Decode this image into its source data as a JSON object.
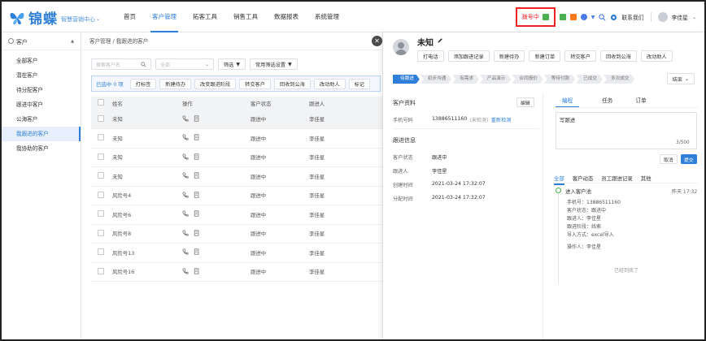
{
  "app": {
    "logo_text": "锦蝶",
    "logo_sub": "智慧营销中心",
    "nav": [
      "首页",
      "客户管理",
      "拓客工具",
      "销售工具",
      "数据报表",
      "系统管理"
    ],
    "nav_active": 1,
    "dial_status": "拨号中",
    "contact_us": "联系我们",
    "user": "李佳星"
  },
  "sidebar": {
    "header": "客户",
    "items": [
      "全部客户",
      "潜在客户",
      "待分配客户",
      "跟进中客户",
      "公海客户",
      "我跟进的客户",
      "我协助的客户"
    ],
    "active": 5
  },
  "breadcrumb": "客户管理 / 我跟进的客户",
  "filters": {
    "search_placeholder": "搜索客户名",
    "all_select": "全部",
    "filter_label": "筛选",
    "common_filter_label": "常用筛选设置"
  },
  "actionbar": {
    "selected": "已选中 0 项",
    "buttons": [
      "打标签",
      "新建待办",
      "改变跟进阶段",
      "转交客户",
      "回收到公海",
      "改动助人",
      "标记"
    ]
  },
  "table": {
    "headers": [
      "姓名",
      "操作",
      "客户状态",
      "跟进人"
    ],
    "rows": [
      {
        "name": "未知",
        "status": "跟进中",
        "owner": "李佳星"
      },
      {
        "name": "未知",
        "status": "跟进中",
        "owner": "李佳星"
      },
      {
        "name": "未知",
        "status": "跟进中",
        "owner": "李佳星"
      },
      {
        "name": "未知",
        "status": "跟进中",
        "owner": "李佳星"
      },
      {
        "name": "风险号4",
        "status": "跟进中",
        "owner": "李佳星"
      },
      {
        "name": "风险号6",
        "status": "跟进中",
        "owner": "李佳星"
      },
      {
        "name": "风险号8",
        "status": "跟进中",
        "owner": "李佳星"
      },
      {
        "name": "风险号13",
        "status": "跟进中",
        "owner": "李佳星"
      },
      {
        "name": "风险号16",
        "status": "跟进中",
        "owner": "李佳星"
      }
    ]
  },
  "detail": {
    "name": "未知",
    "quick_actions": [
      "打电话",
      "添加跟进记录",
      "新建待办",
      "新建订单",
      "转交客户",
      "回收到公海",
      "改动助人"
    ],
    "stages": [
      "待跟进",
      "初步沟通",
      "有需求",
      "产品演示",
      "合同报价",
      "等待付款",
      "已成交",
      "多次成交"
    ],
    "current_stage": 0,
    "end_select": "结束",
    "profile_title": "客户资料",
    "edit_label": "编辑",
    "phone_label": "手机号码",
    "phone": "13886511160",
    "phone_status": "(未检测)",
    "recheck": "重新检测",
    "followup_title": "跟进信息",
    "fields": [
      {
        "k": "客户状态",
        "v": "跟进中"
      },
      {
        "k": "跟进人",
        "v": "李佳星"
      },
      {
        "k": "创建时间",
        "v": "2021-03-24 17:32:07"
      },
      {
        "k": "分配时间",
        "v": "2021-03-24 17:32:07"
      }
    ],
    "right_tabs": [
      "编程",
      "任务",
      "订单"
    ],
    "note_text": "写跟进",
    "note_counter": "3/500",
    "cancel": "取消",
    "submit": "提交",
    "feed_tabs": [
      "全部",
      "客户动态",
      "员工跟进记录",
      "其他"
    ],
    "timeline": {
      "title": "进入客户池",
      "time": "昨天 17:32",
      "lines": [
        "手机号：13886511160",
        "客户状态：跟进中",
        "跟进人：李佳星",
        "跟进阶段：线索",
        "导入方式：excel导入"
      ],
      "operator": "操作人：李佳星",
      "end": "已经到底了"
    }
  },
  "colors": {
    "accent": "#2f7fd9",
    "dial_red": "#e22222"
  }
}
